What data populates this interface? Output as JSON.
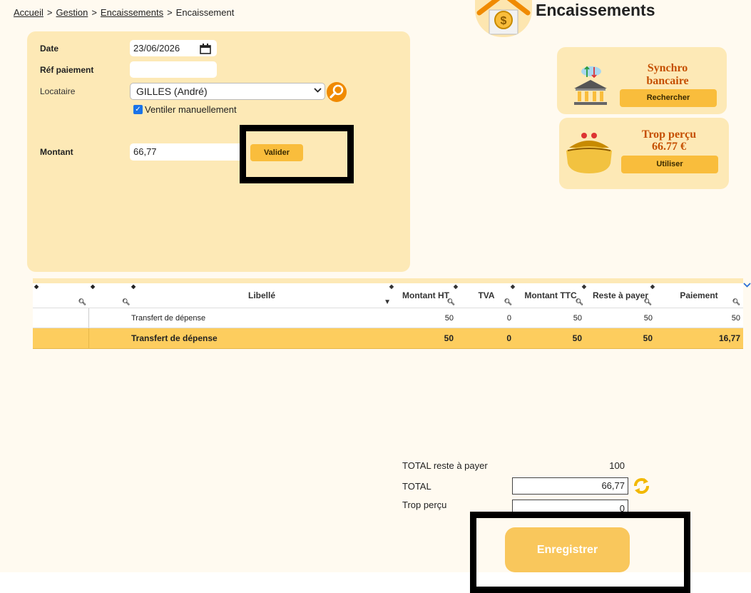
{
  "breadcrumb": {
    "items": [
      "Accueil",
      "Gestion",
      "Encaissements"
    ],
    "current": "Encaissement",
    "separator": ">"
  },
  "header": {
    "title": "Encaissements",
    "logo_icon": "house-money-icon"
  },
  "form": {
    "date_label": "Date",
    "date_value": "23/06/2026",
    "ref_label": "Réf paiement",
    "ref_value": "",
    "locataire_label": "Locataire",
    "locataire_value": "GILLES (André)",
    "ventiler_label": "Ventiler manuellement",
    "ventiler_checked": true,
    "montant_label": "Montant",
    "montant_value": "66,77",
    "valider_label": "Valider"
  },
  "cards": {
    "synchro": {
      "title_line1": "Synchro",
      "title_line2": "bancaire",
      "button": "Rechercher",
      "icon": "bank-sync-icon"
    },
    "trop_percu": {
      "title": "Trop perçu",
      "amount": "66.77 €",
      "button": "Utiliser",
      "icon": "purse-icon"
    }
  },
  "table": {
    "columns": [
      "",
      "",
      "Libellé",
      "Montant HT",
      "TVA",
      "Montant TTC",
      "Reste à payer",
      "Paiement"
    ],
    "rows": [
      {
        "libelle": "Transfert de dépense",
        "ht": "50",
        "tva": "0",
        "ttc": "50",
        "reste": "50",
        "paiement": "50"
      }
    ],
    "total": {
      "libelle": "Transfert de dépense",
      "ht": "50",
      "tva": "0",
      "ttc": "50",
      "reste": "50",
      "paiement": "16,77"
    }
  },
  "totals": {
    "reste_label": "TOTAL reste à payer",
    "reste_value": "100",
    "total_label": "TOTAL",
    "total_value": "66,77",
    "trop_label": "Trop perçu",
    "trop_value": "0"
  },
  "save_button": "Enregistrer",
  "colors": {
    "panel": "#fde9b6",
    "accent": "#f9bd3c",
    "total_row": "#fdcd5e",
    "card_title": "#c54f00"
  }
}
